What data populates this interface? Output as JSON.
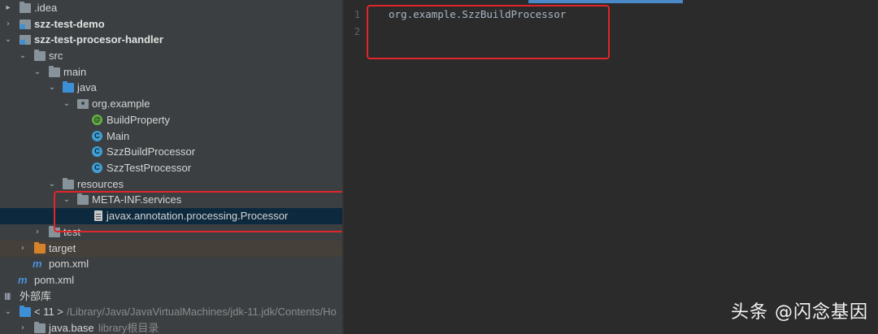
{
  "project_tree": [
    {
      "label": ".idea",
      "bold": false
    },
    {
      "label": "szz-test-demo",
      "bold": true
    },
    {
      "label": "szz-test-procesor-handler",
      "bold": true
    },
    {
      "label": "src"
    },
    {
      "label": "main"
    },
    {
      "label": "java"
    },
    {
      "label": "org.example"
    },
    {
      "label": "BuildProperty"
    },
    {
      "label": "Main"
    },
    {
      "label": "SzzBuildProcessor"
    },
    {
      "label": "SzzTestProcessor"
    },
    {
      "label": "resources"
    },
    {
      "label": "META-INF.services"
    },
    {
      "label": "javax.annotation.processing.Processor"
    },
    {
      "label": "test"
    },
    {
      "label": "target"
    },
    {
      "label": "pom.xml"
    },
    {
      "label": "pom.xml"
    },
    {
      "label": "外部库"
    },
    {
      "label": "< 11 >",
      "path": "/Library/Java/JavaVirtualMachines/jdk-11.jdk/Contents/Ho"
    },
    {
      "label": "java.base",
      "sub": "library根目录"
    }
  ],
  "editor": {
    "line_numbers": [
      "1",
      "2"
    ],
    "lines": [
      "org.example.SzzBuildProcessor",
      ""
    ]
  },
  "icons": {
    "maven_glyph": "m",
    "class_glyph": "C",
    "spring_glyph": "@",
    "library_glyph": "Illl"
  },
  "watermark": "头条 @闪念基因",
  "colors": {
    "highlight_box": "#e0252b",
    "selected_row": "#0d293e",
    "sidebar_bg": "#3c3f41",
    "editor_bg": "#2b2b2b"
  }
}
